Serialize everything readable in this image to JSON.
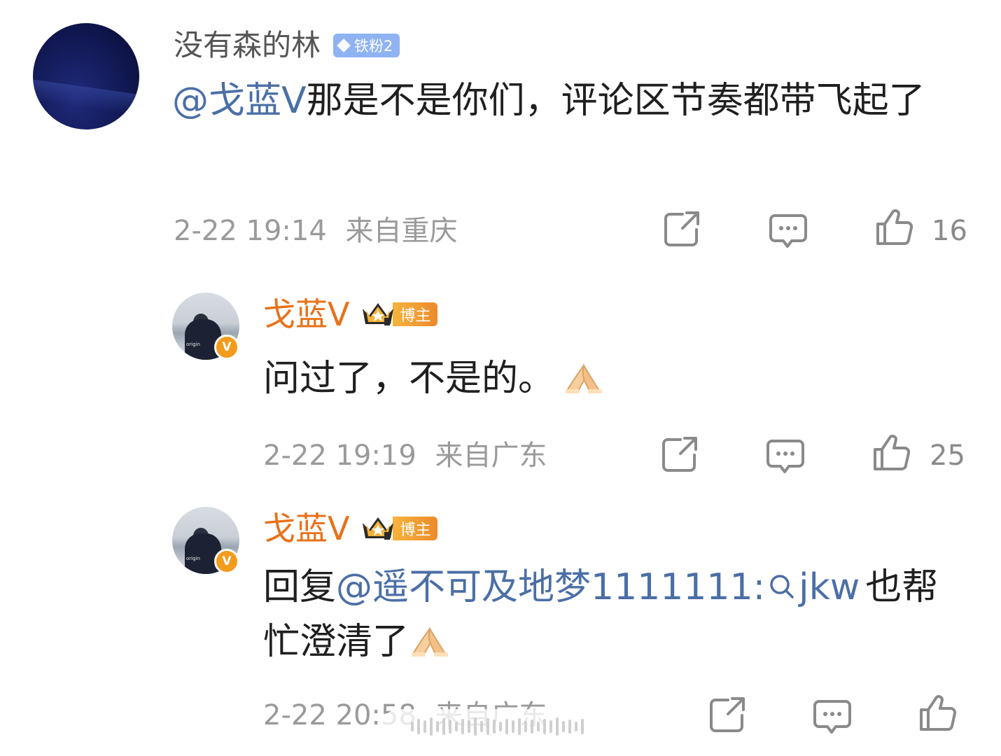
{
  "comment": {
    "username": "没有森的林",
    "fan_badge": "铁粉2",
    "mention": "@戈蓝V",
    "text": "那是不是你们，评论区节奏都带飞起了",
    "time": "2-22 19:14",
    "location": "来自重庆",
    "likes": "16"
  },
  "replies": [
    {
      "username": "戈蓝V",
      "role_tag": "博主",
      "verified_mark": "V",
      "text": "问过了，不是的。",
      "time": "2-22 19:19",
      "location": "来自广东",
      "likes": "25"
    },
    {
      "username": "戈蓝V",
      "role_tag": "博主",
      "verified_mark": "V",
      "reply_prefix": "回复",
      "mention": "@遥不可及地梦1111111",
      "colon": ":",
      "search_keyword": "jkw",
      "text": "也帮忙澄清了",
      "time": "2-22 20:58",
      "location": "来自广东",
      "likes": ""
    }
  ],
  "avatar_brand_text": "origin",
  "colors": {
    "mention": "#4b6fa6",
    "host_name": "#e8711b",
    "meta_gray": "#9a9a9a",
    "fan_badge": "#8fb3f2"
  }
}
